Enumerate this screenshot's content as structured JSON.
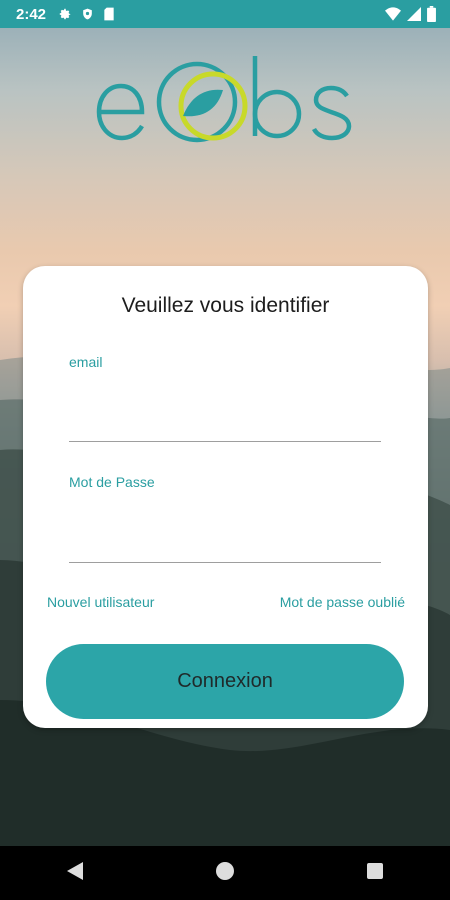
{
  "status_bar": {
    "time": "2:42",
    "left_icons": [
      "gear-icon",
      "shield-icon",
      "sd-card-icon"
    ],
    "right_icons": [
      "wifi-icon",
      "signal-icon",
      "battery-icon"
    ],
    "color": "#2a9ea1"
  },
  "logo": {
    "text": "eObs",
    "primary_color": "#2a9ea1",
    "accent_color": "#c8d92a"
  },
  "login_card": {
    "title": "Veuillez vous identifier",
    "email_label": "email",
    "email_value": "",
    "password_label": "Mot de Passe",
    "password_value": "",
    "new_user_link": "Nouvel utilisateur",
    "forgot_password_link": "Mot de passe oublié",
    "submit_label": "Connexion",
    "accent_color": "#2a9ea1"
  },
  "nav_bar": {
    "buttons": [
      "back-icon",
      "home-icon",
      "recents-icon"
    ]
  }
}
